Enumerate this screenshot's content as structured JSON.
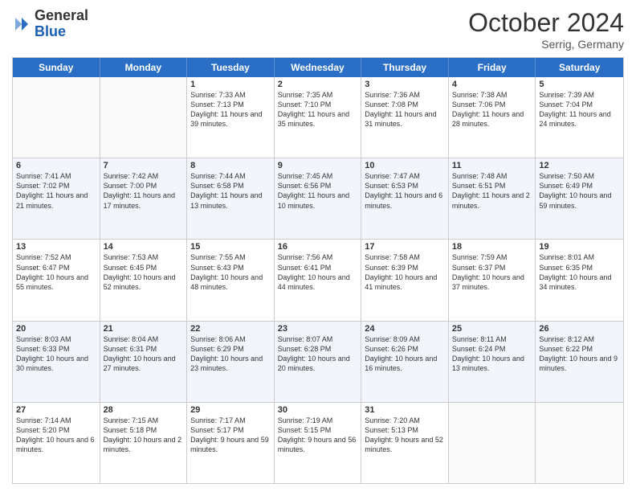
{
  "header": {
    "logo_general": "General",
    "logo_blue": "Blue",
    "month_title": "October 2024",
    "location": "Serrig, Germany"
  },
  "days_of_week": [
    "Sunday",
    "Monday",
    "Tuesday",
    "Wednesday",
    "Thursday",
    "Friday",
    "Saturday"
  ],
  "rows": [
    [
      {
        "day": "",
        "sunrise": "",
        "sunset": "",
        "daylight": "",
        "empty": true
      },
      {
        "day": "",
        "sunrise": "",
        "sunset": "",
        "daylight": "",
        "empty": true
      },
      {
        "day": "1",
        "sunrise": "Sunrise: 7:33 AM",
        "sunset": "Sunset: 7:13 PM",
        "daylight": "Daylight: 11 hours and 39 minutes."
      },
      {
        "day": "2",
        "sunrise": "Sunrise: 7:35 AM",
        "sunset": "Sunset: 7:10 PM",
        "daylight": "Daylight: 11 hours and 35 minutes."
      },
      {
        "day": "3",
        "sunrise": "Sunrise: 7:36 AM",
        "sunset": "Sunset: 7:08 PM",
        "daylight": "Daylight: 11 hours and 31 minutes."
      },
      {
        "day": "4",
        "sunrise": "Sunrise: 7:38 AM",
        "sunset": "Sunset: 7:06 PM",
        "daylight": "Daylight: 11 hours and 28 minutes."
      },
      {
        "day": "5",
        "sunrise": "Sunrise: 7:39 AM",
        "sunset": "Sunset: 7:04 PM",
        "daylight": "Daylight: 11 hours and 24 minutes."
      }
    ],
    [
      {
        "day": "6",
        "sunrise": "Sunrise: 7:41 AM",
        "sunset": "Sunset: 7:02 PM",
        "daylight": "Daylight: 11 hours and 21 minutes."
      },
      {
        "day": "7",
        "sunrise": "Sunrise: 7:42 AM",
        "sunset": "Sunset: 7:00 PM",
        "daylight": "Daylight: 11 hours and 17 minutes."
      },
      {
        "day": "8",
        "sunrise": "Sunrise: 7:44 AM",
        "sunset": "Sunset: 6:58 PM",
        "daylight": "Daylight: 11 hours and 13 minutes."
      },
      {
        "day": "9",
        "sunrise": "Sunrise: 7:45 AM",
        "sunset": "Sunset: 6:56 PM",
        "daylight": "Daylight: 11 hours and 10 minutes."
      },
      {
        "day": "10",
        "sunrise": "Sunrise: 7:47 AM",
        "sunset": "Sunset: 6:53 PM",
        "daylight": "Daylight: 11 hours and 6 minutes."
      },
      {
        "day": "11",
        "sunrise": "Sunrise: 7:48 AM",
        "sunset": "Sunset: 6:51 PM",
        "daylight": "Daylight: 11 hours and 2 minutes."
      },
      {
        "day": "12",
        "sunrise": "Sunrise: 7:50 AM",
        "sunset": "Sunset: 6:49 PM",
        "daylight": "Daylight: 10 hours and 59 minutes."
      }
    ],
    [
      {
        "day": "13",
        "sunrise": "Sunrise: 7:52 AM",
        "sunset": "Sunset: 6:47 PM",
        "daylight": "Daylight: 10 hours and 55 minutes."
      },
      {
        "day": "14",
        "sunrise": "Sunrise: 7:53 AM",
        "sunset": "Sunset: 6:45 PM",
        "daylight": "Daylight: 10 hours and 52 minutes."
      },
      {
        "day": "15",
        "sunrise": "Sunrise: 7:55 AM",
        "sunset": "Sunset: 6:43 PM",
        "daylight": "Daylight: 10 hours and 48 minutes."
      },
      {
        "day": "16",
        "sunrise": "Sunrise: 7:56 AM",
        "sunset": "Sunset: 6:41 PM",
        "daylight": "Daylight: 10 hours and 44 minutes."
      },
      {
        "day": "17",
        "sunrise": "Sunrise: 7:58 AM",
        "sunset": "Sunset: 6:39 PM",
        "daylight": "Daylight: 10 hours and 41 minutes."
      },
      {
        "day": "18",
        "sunrise": "Sunrise: 7:59 AM",
        "sunset": "Sunset: 6:37 PM",
        "daylight": "Daylight: 10 hours and 37 minutes."
      },
      {
        "day": "19",
        "sunrise": "Sunrise: 8:01 AM",
        "sunset": "Sunset: 6:35 PM",
        "daylight": "Daylight: 10 hours and 34 minutes."
      }
    ],
    [
      {
        "day": "20",
        "sunrise": "Sunrise: 8:03 AM",
        "sunset": "Sunset: 6:33 PM",
        "daylight": "Daylight: 10 hours and 30 minutes."
      },
      {
        "day": "21",
        "sunrise": "Sunrise: 8:04 AM",
        "sunset": "Sunset: 6:31 PM",
        "daylight": "Daylight: 10 hours and 27 minutes."
      },
      {
        "day": "22",
        "sunrise": "Sunrise: 8:06 AM",
        "sunset": "Sunset: 6:29 PM",
        "daylight": "Daylight: 10 hours and 23 minutes."
      },
      {
        "day": "23",
        "sunrise": "Sunrise: 8:07 AM",
        "sunset": "Sunset: 6:28 PM",
        "daylight": "Daylight: 10 hours and 20 minutes."
      },
      {
        "day": "24",
        "sunrise": "Sunrise: 8:09 AM",
        "sunset": "Sunset: 6:26 PM",
        "daylight": "Daylight: 10 hours and 16 minutes."
      },
      {
        "day": "25",
        "sunrise": "Sunrise: 8:11 AM",
        "sunset": "Sunset: 6:24 PM",
        "daylight": "Daylight: 10 hours and 13 minutes."
      },
      {
        "day": "26",
        "sunrise": "Sunrise: 8:12 AM",
        "sunset": "Sunset: 6:22 PM",
        "daylight": "Daylight: 10 hours and 9 minutes."
      }
    ],
    [
      {
        "day": "27",
        "sunrise": "Sunrise: 7:14 AM",
        "sunset": "Sunset: 5:20 PM",
        "daylight": "Daylight: 10 hours and 6 minutes."
      },
      {
        "day": "28",
        "sunrise": "Sunrise: 7:15 AM",
        "sunset": "Sunset: 5:18 PM",
        "daylight": "Daylight: 10 hours and 2 minutes."
      },
      {
        "day": "29",
        "sunrise": "Sunrise: 7:17 AM",
        "sunset": "Sunset: 5:17 PM",
        "daylight": "Daylight: 9 hours and 59 minutes."
      },
      {
        "day": "30",
        "sunrise": "Sunrise: 7:19 AM",
        "sunset": "Sunset: 5:15 PM",
        "daylight": "Daylight: 9 hours and 56 minutes."
      },
      {
        "day": "31",
        "sunrise": "Sunrise: 7:20 AM",
        "sunset": "Sunset: 5:13 PM",
        "daylight": "Daylight: 9 hours and 52 minutes."
      },
      {
        "day": "",
        "sunrise": "",
        "sunset": "",
        "daylight": "",
        "empty": true
      },
      {
        "day": "",
        "sunrise": "",
        "sunset": "",
        "daylight": "",
        "empty": true
      }
    ]
  ]
}
